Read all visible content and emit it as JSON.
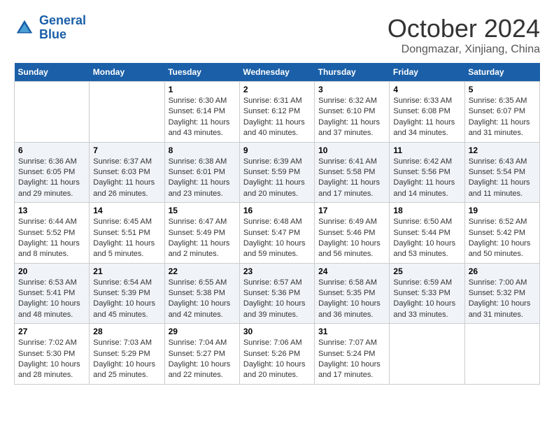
{
  "header": {
    "logo_line1": "General",
    "logo_line2": "Blue",
    "month": "October 2024",
    "location": "Dongmazar, Xinjiang, China"
  },
  "days_of_week": [
    "Sunday",
    "Monday",
    "Tuesday",
    "Wednesday",
    "Thursday",
    "Friday",
    "Saturday"
  ],
  "weeks": [
    [
      {
        "day": "",
        "sunrise": "",
        "sunset": "",
        "daylight": ""
      },
      {
        "day": "",
        "sunrise": "",
        "sunset": "",
        "daylight": ""
      },
      {
        "day": "1",
        "sunrise": "Sunrise: 6:30 AM",
        "sunset": "Sunset: 6:14 PM",
        "daylight": "Daylight: 11 hours and 43 minutes."
      },
      {
        "day": "2",
        "sunrise": "Sunrise: 6:31 AM",
        "sunset": "Sunset: 6:12 PM",
        "daylight": "Daylight: 11 hours and 40 minutes."
      },
      {
        "day": "3",
        "sunrise": "Sunrise: 6:32 AM",
        "sunset": "Sunset: 6:10 PM",
        "daylight": "Daylight: 11 hours and 37 minutes."
      },
      {
        "day": "4",
        "sunrise": "Sunrise: 6:33 AM",
        "sunset": "Sunset: 6:08 PM",
        "daylight": "Daylight: 11 hours and 34 minutes."
      },
      {
        "day": "5",
        "sunrise": "Sunrise: 6:35 AM",
        "sunset": "Sunset: 6:07 PM",
        "daylight": "Daylight: 11 hours and 31 minutes."
      }
    ],
    [
      {
        "day": "6",
        "sunrise": "Sunrise: 6:36 AM",
        "sunset": "Sunset: 6:05 PM",
        "daylight": "Daylight: 11 hours and 29 minutes."
      },
      {
        "day": "7",
        "sunrise": "Sunrise: 6:37 AM",
        "sunset": "Sunset: 6:03 PM",
        "daylight": "Daylight: 11 hours and 26 minutes."
      },
      {
        "day": "8",
        "sunrise": "Sunrise: 6:38 AM",
        "sunset": "Sunset: 6:01 PM",
        "daylight": "Daylight: 11 hours and 23 minutes."
      },
      {
        "day": "9",
        "sunrise": "Sunrise: 6:39 AM",
        "sunset": "Sunset: 5:59 PM",
        "daylight": "Daylight: 11 hours and 20 minutes."
      },
      {
        "day": "10",
        "sunrise": "Sunrise: 6:41 AM",
        "sunset": "Sunset: 5:58 PM",
        "daylight": "Daylight: 11 hours and 17 minutes."
      },
      {
        "day": "11",
        "sunrise": "Sunrise: 6:42 AM",
        "sunset": "Sunset: 5:56 PM",
        "daylight": "Daylight: 11 hours and 14 minutes."
      },
      {
        "day": "12",
        "sunrise": "Sunrise: 6:43 AM",
        "sunset": "Sunset: 5:54 PM",
        "daylight": "Daylight: 11 hours and 11 minutes."
      }
    ],
    [
      {
        "day": "13",
        "sunrise": "Sunrise: 6:44 AM",
        "sunset": "Sunset: 5:52 PM",
        "daylight": "Daylight: 11 hours and 8 minutes."
      },
      {
        "day": "14",
        "sunrise": "Sunrise: 6:45 AM",
        "sunset": "Sunset: 5:51 PM",
        "daylight": "Daylight: 11 hours and 5 minutes."
      },
      {
        "day": "15",
        "sunrise": "Sunrise: 6:47 AM",
        "sunset": "Sunset: 5:49 PM",
        "daylight": "Daylight: 11 hours and 2 minutes."
      },
      {
        "day": "16",
        "sunrise": "Sunrise: 6:48 AM",
        "sunset": "Sunset: 5:47 PM",
        "daylight": "Daylight: 10 hours and 59 minutes."
      },
      {
        "day": "17",
        "sunrise": "Sunrise: 6:49 AM",
        "sunset": "Sunset: 5:46 PM",
        "daylight": "Daylight: 10 hours and 56 minutes."
      },
      {
        "day": "18",
        "sunrise": "Sunrise: 6:50 AM",
        "sunset": "Sunset: 5:44 PM",
        "daylight": "Daylight: 10 hours and 53 minutes."
      },
      {
        "day": "19",
        "sunrise": "Sunrise: 6:52 AM",
        "sunset": "Sunset: 5:42 PM",
        "daylight": "Daylight: 10 hours and 50 minutes."
      }
    ],
    [
      {
        "day": "20",
        "sunrise": "Sunrise: 6:53 AM",
        "sunset": "Sunset: 5:41 PM",
        "daylight": "Daylight: 10 hours and 48 minutes."
      },
      {
        "day": "21",
        "sunrise": "Sunrise: 6:54 AM",
        "sunset": "Sunset: 5:39 PM",
        "daylight": "Daylight: 10 hours and 45 minutes."
      },
      {
        "day": "22",
        "sunrise": "Sunrise: 6:55 AM",
        "sunset": "Sunset: 5:38 PM",
        "daylight": "Daylight: 10 hours and 42 minutes."
      },
      {
        "day": "23",
        "sunrise": "Sunrise: 6:57 AM",
        "sunset": "Sunset: 5:36 PM",
        "daylight": "Daylight: 10 hours and 39 minutes."
      },
      {
        "day": "24",
        "sunrise": "Sunrise: 6:58 AM",
        "sunset": "Sunset: 5:35 PM",
        "daylight": "Daylight: 10 hours and 36 minutes."
      },
      {
        "day": "25",
        "sunrise": "Sunrise: 6:59 AM",
        "sunset": "Sunset: 5:33 PM",
        "daylight": "Daylight: 10 hours and 33 minutes."
      },
      {
        "day": "26",
        "sunrise": "Sunrise: 7:00 AM",
        "sunset": "Sunset: 5:32 PM",
        "daylight": "Daylight: 10 hours and 31 minutes."
      }
    ],
    [
      {
        "day": "27",
        "sunrise": "Sunrise: 7:02 AM",
        "sunset": "Sunset: 5:30 PM",
        "daylight": "Daylight: 10 hours and 28 minutes."
      },
      {
        "day": "28",
        "sunrise": "Sunrise: 7:03 AM",
        "sunset": "Sunset: 5:29 PM",
        "daylight": "Daylight: 10 hours and 25 minutes."
      },
      {
        "day": "29",
        "sunrise": "Sunrise: 7:04 AM",
        "sunset": "Sunset: 5:27 PM",
        "daylight": "Daylight: 10 hours and 22 minutes."
      },
      {
        "day": "30",
        "sunrise": "Sunrise: 7:06 AM",
        "sunset": "Sunset: 5:26 PM",
        "daylight": "Daylight: 10 hours and 20 minutes."
      },
      {
        "day": "31",
        "sunrise": "Sunrise: 7:07 AM",
        "sunset": "Sunset: 5:24 PM",
        "daylight": "Daylight: 10 hours and 17 minutes."
      },
      {
        "day": "",
        "sunrise": "",
        "sunset": "",
        "daylight": ""
      },
      {
        "day": "",
        "sunrise": "",
        "sunset": "",
        "daylight": ""
      }
    ]
  ]
}
